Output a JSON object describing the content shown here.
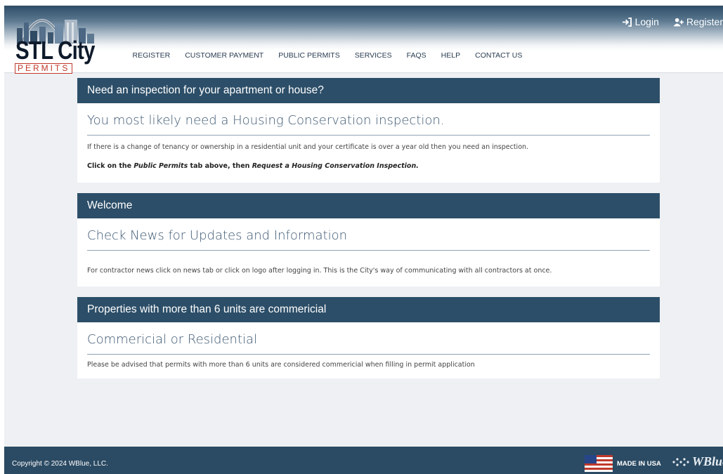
{
  "header": {
    "logo": {
      "line1": "STL City",
      "line2": "PERMITS"
    },
    "nav": [
      "REGISTER",
      "CUSTOMER PAYMENT",
      "PUBLIC PERMITS",
      "SERVICES",
      "FAQS",
      "HELP",
      "CONTACT US"
    ],
    "top_links": {
      "login": "Login",
      "register": "Register"
    }
  },
  "panels": [
    {
      "title": "Need an inspection for your apartment or house?",
      "subtitle": "You most likely need a Housing Conservation inspection.",
      "text": "If there is a change of tenancy or ownership in a residential unit and your certificate is over a year old then you need an inspection.",
      "instruction": {
        "prefix": "Click on the ",
        "tab_name": "Public Permits",
        "middle": " tab above, then ",
        "action": "Request a Housing Conservation Inspection."
      }
    },
    {
      "title": "Welcome",
      "subtitle": "Check News for Updates and Information",
      "text": "For contractor news click on news tab or click on logo after logging in. This is the City's way of communicating with all contractors at once."
    },
    {
      "title": "Properties with more than 6 units are commericial",
      "subtitle": "Commericial or Residential",
      "text": "Please be advised that permits with more than 6 units are considered commericial when filling in permit application"
    }
  ],
  "footer": {
    "copyright": "Copyright © 2024 WBlue, LLC.",
    "made_in": "MADE IN USA",
    "brand": "WBlue"
  },
  "colors": {
    "header_dark": "#2e4c66",
    "panel_header": "#2c4e68",
    "footer": "#2b4a63",
    "logo_red": "#c0392b"
  },
  "icons": [
    "login-icon",
    "register-user-icon",
    "us-flag-icon",
    "wblue-logo-icon",
    "skyline-logo-icon"
  ]
}
